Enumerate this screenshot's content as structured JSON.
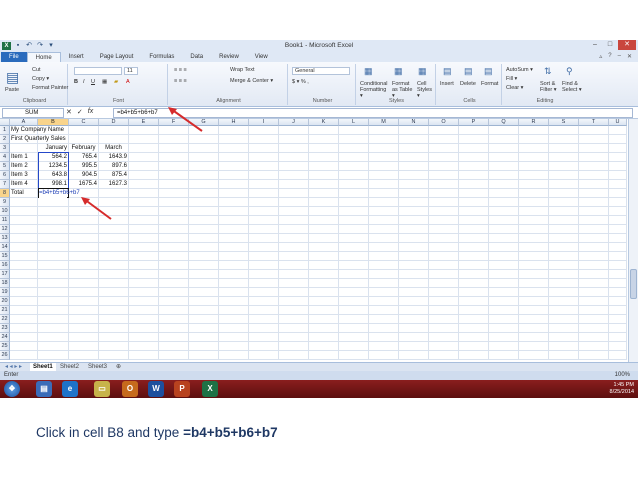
{
  "window": {
    "title": "Book1 - Microsoft Excel"
  },
  "tabs": [
    "File",
    "Home",
    "Insert",
    "Page Layout",
    "Formulas",
    "Data",
    "Review",
    "View"
  ],
  "ribbon": {
    "clipboard": {
      "label": "Clipboard",
      "paste": "Paste",
      "cut": "Cut",
      "copy": "Copy ▾",
      "format_painter": "Format Painter"
    },
    "font": {
      "label": "Font",
      "size": "11"
    },
    "alignment": {
      "label": "Alignment",
      "wrap": "Wrap Text",
      "merge": "Merge & Center ▾"
    },
    "number": {
      "label": "Number",
      "format": "General"
    },
    "styles": {
      "label": "Styles",
      "cond": "Conditional Formatting ▾",
      "table": "Format as Table ▾",
      "cell": "Cell Styles ▾"
    },
    "cells": {
      "label": "Cells",
      "insert": "Insert",
      "delete": "Delete",
      "format": "Format"
    },
    "editing": {
      "label": "Editing",
      "autosum": "AutoSum ▾",
      "fill": "Fill ▾",
      "clear": "Clear ▾",
      "sort": "Sort & Filter ▾",
      "find": "Find & Select ▾"
    }
  },
  "formula_bar": {
    "name_box": "SUM",
    "fx": "fx",
    "content": "=b4+b5+b6+b7"
  },
  "columns": [
    "A",
    "B",
    "C",
    "D",
    "E",
    "F",
    "G",
    "H",
    "I",
    "J",
    "K",
    "L",
    "M",
    "N",
    "O",
    "P",
    "Q",
    "R",
    "S",
    "T",
    "U"
  ],
  "rows": [
    "1",
    "2",
    "3",
    "4",
    "5",
    "6",
    "7",
    "8",
    "9",
    "10",
    "11",
    "12",
    "13",
    "14",
    "15",
    "16",
    "17",
    "18",
    "19",
    "20",
    "21",
    "22",
    "23",
    "24",
    "25",
    "26"
  ],
  "cells": {
    "a1": "My Company Name",
    "a2": "First Quarterly Sales",
    "b3": "January",
    "c3": "February",
    "d3": "March",
    "a4": "Item 1",
    "b4": "564.2",
    "c4": "765.4",
    "d4": "1643.9",
    "a5": "Item 2",
    "b5": "1234.5",
    "c5": "995.5",
    "d5": "897.6",
    "a6": "Item 3",
    "b6": "643.8",
    "c6": "904.5",
    "d6": "875.4",
    "a7": "Item 4",
    "b7": "998.1",
    "c7": "1675.4",
    "d7": "1627.3",
    "a8": "Total",
    "b8": "=b4+b5+b6+b7"
  },
  "sheets": [
    "Sheet1",
    "Sheet2",
    "Sheet3"
  ],
  "status": {
    "mode": "Enter",
    "zoom": "100%"
  },
  "taskbar": {
    "time": "1:45 PM",
    "date": "8/25/2014"
  },
  "caption": {
    "text": "Click in cell B8 and type ",
    "bold": "=b4+b5+b6+b7"
  },
  "colors": {
    "arrow": "#d62b2b",
    "caption": "#1f3864",
    "excel_green": "#1e7145"
  }
}
